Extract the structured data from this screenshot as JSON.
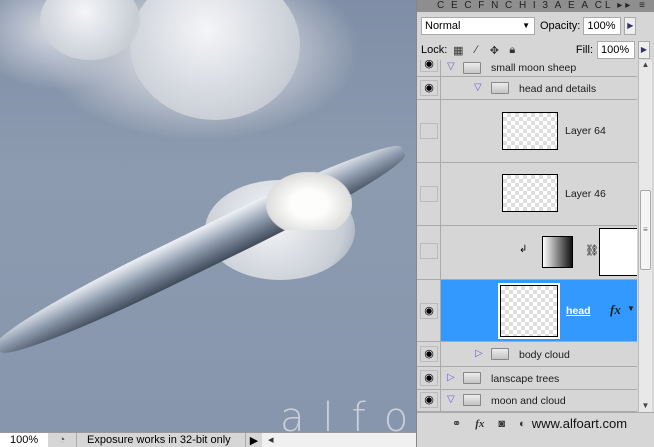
{
  "canvas": {
    "watermark": "alfo"
  },
  "status": {
    "zoom": "100%",
    "message": "Exposure works in 32-bit only"
  },
  "panel": {
    "tabs": [
      "C",
      "E",
      "C",
      "F",
      "N",
      "C",
      "H",
      "I",
      "3",
      "A",
      "E",
      "A",
      "CL"
    ],
    "blend_mode": "Normal",
    "opacity_label": "Opacity:",
    "opacity": "100%",
    "lock_label": "Lock:",
    "fill_label": "Fill:",
    "fill": "100%",
    "layers": [
      {
        "name": "small moon sheep",
        "type": "group",
        "visible": true
      },
      {
        "name": "head and details",
        "type": "group",
        "visible": true
      },
      {
        "name": "Layer 64",
        "type": "layer",
        "visible": false
      },
      {
        "name": "Layer 46",
        "type": "layer",
        "visible": false
      },
      {
        "name": "",
        "type": "adjustment",
        "visible": false
      },
      {
        "name": "head",
        "type": "layer",
        "visible": true,
        "selected": true
      },
      {
        "name": "body cloud",
        "type": "group",
        "visible": true
      },
      {
        "name": "lanscape trees",
        "type": "group",
        "visible": true
      },
      {
        "name": "moon and cloud",
        "type": "group",
        "visible": true
      }
    ],
    "footer_url": "www.alfoart.com"
  },
  "colors": {
    "selection": "#3399ff"
  }
}
